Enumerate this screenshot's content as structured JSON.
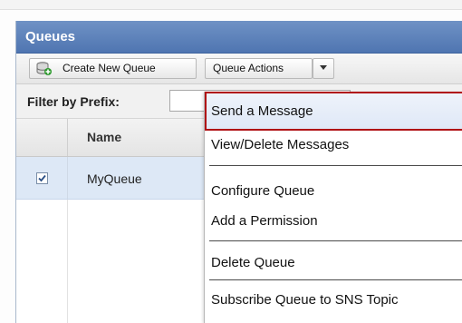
{
  "panel": {
    "title": "Queues"
  },
  "toolbar": {
    "create_label": "Create New Queue",
    "actions_label": "Queue Actions"
  },
  "filter": {
    "label": "Filter by Prefix:",
    "value": ""
  },
  "grid": {
    "columns": [
      "Name"
    ],
    "rows": [
      {
        "name": "MyQueue",
        "checked": true
      }
    ]
  },
  "menu": {
    "items": [
      {
        "label": "Send a Message",
        "highlighted": true
      },
      {
        "label": "View/Delete Messages"
      },
      {
        "label": "Configure Queue"
      },
      {
        "label": "Add a Permission"
      },
      {
        "label": "Delete Queue"
      },
      {
        "label": "Subscribe Queue to SNS Topic"
      }
    ]
  },
  "icons": {
    "create": "database-add-icon",
    "caret": "chevron-down-icon",
    "checkbox": "checkmark-icon"
  },
  "colors": {
    "header": "#5b80b9",
    "selection_border": "#b00f14",
    "row_selected": "#dde8f6"
  }
}
